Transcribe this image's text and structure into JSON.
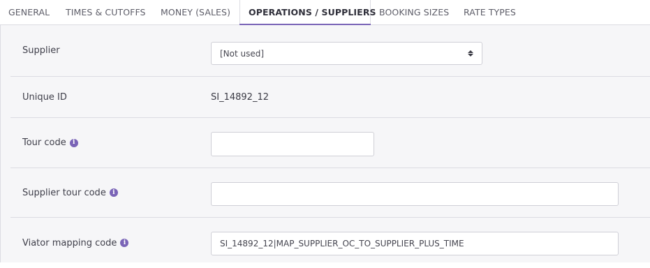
{
  "tabs": [
    {
      "label": "GENERAL",
      "active": false
    },
    {
      "label": "TIMES & CUTOFFS",
      "active": false
    },
    {
      "label": "MONEY (SALES)",
      "active": false
    },
    {
      "label": "OPERATIONS / SUPPLIERS",
      "active": true
    },
    {
      "label": "BOOKING SIZES",
      "active": false
    },
    {
      "label": "RATE TYPES",
      "active": false
    }
  ],
  "form": {
    "supplier": {
      "label": "Supplier",
      "value": "[Not used]"
    },
    "unique_id": {
      "label": "Unique ID",
      "value": "SI_14892_12"
    },
    "tour_code": {
      "label": "Tour code",
      "value": "",
      "icon": "info-icon"
    },
    "supplier_tour_code": {
      "label": "Supplier tour code",
      "value": "",
      "icon": "info-icon"
    },
    "viator_mapping_code": {
      "label": "Viator mapping code",
      "value": "SI_14892_12|MAP_SUPPLIER_OC_TO_SUPPLIER_PLUS_TIME",
      "icon": "info-icon"
    }
  },
  "colors": {
    "accent": "#7a64b7",
    "panel_bg": "#f6f6f8",
    "border": "#dcdce2"
  }
}
